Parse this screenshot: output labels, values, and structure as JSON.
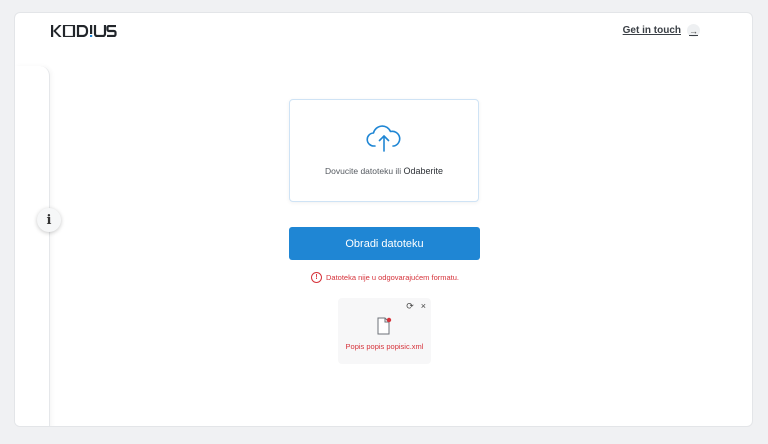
{
  "header": {
    "logo_text": "KODIUS",
    "contact_label": "Get in touch",
    "contact_arrow": "→"
  },
  "sidebar": {
    "info_label": "i"
  },
  "upload": {
    "prompt_text": "Dovucite datoteku ili ",
    "choose_label": "Odaberite"
  },
  "actions": {
    "process_label": "Obradi datoteku"
  },
  "error": {
    "message": "Datoteka nije u odgovarajućem formatu.",
    "icon": "!"
  },
  "file": {
    "name": "Popis popis popisic.xml",
    "replace_icon": "⟳",
    "remove_icon": "×"
  },
  "colors": {
    "accent": "#1f86d4",
    "error": "#d6333b",
    "logo_dot": "#1f86d4"
  }
}
